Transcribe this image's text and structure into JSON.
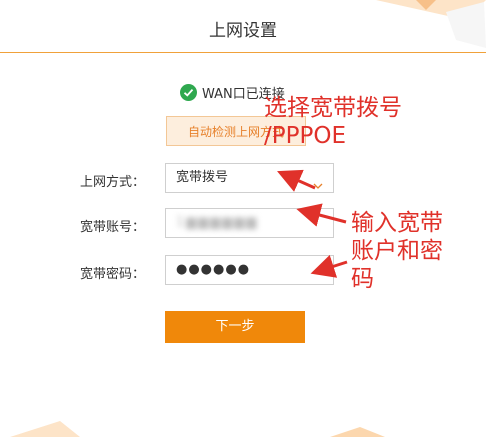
{
  "header": {
    "title": "上网设置"
  },
  "status": {
    "wan_text": "WAN口已连接",
    "color": "#2fa84f"
  },
  "auto_detect": {
    "label": "自动检测上网方式"
  },
  "form": {
    "mode_label": "上网方式：",
    "mode_value": "宽带拨号",
    "account_label": "宽带账号：",
    "account_value": "1▆▆▆▆▆▆",
    "password_label": "宽带密码：",
    "password_value": "●●●●●●"
  },
  "next_button": {
    "label": "下一步",
    "color": "#f0880a"
  },
  "annotations": {
    "pppoe_line1": "选择宽带拨号",
    "pppoe_line2": "/PPPOE",
    "account_line1": "输入宽带",
    "account_line2": "账户和密",
    "account_line3": "码",
    "color": "#e0312a"
  }
}
